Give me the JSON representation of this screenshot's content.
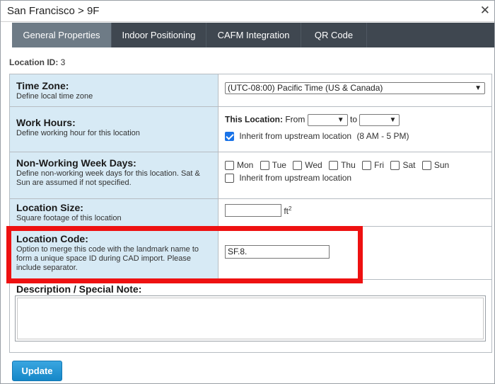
{
  "window": {
    "title": "San Francisco > 9F",
    "close_glyph": "✕"
  },
  "tabs": [
    {
      "label": "General Properties",
      "active": true
    },
    {
      "label": "Indoor Positioning",
      "active": false
    },
    {
      "label": "CAFM Integration",
      "active": false
    },
    {
      "label": "QR Code",
      "active": false
    }
  ],
  "location_id": {
    "label": "Location ID:",
    "value": "3"
  },
  "time_zone": {
    "title": "Time Zone:",
    "desc": "Define local time zone",
    "value": "(UTC-08:00) Pacific Time (US & Canada)"
  },
  "work_hours": {
    "title": "Work Hours:",
    "desc": "Define working hour for this location",
    "this_location_label": "This Location:",
    "from_label": "From",
    "to_label": "to",
    "from_value": "",
    "to_value": "",
    "inherit_label": "Inherit from upstream location",
    "inherit_checked": true,
    "inherit_hours": "(8 AM - 5 PM)"
  },
  "non_working": {
    "title": "Non-Working Week Days:",
    "desc": "Define non-working week days for this location. Sat & Sun are assumed if not specified.",
    "days": [
      "Mon",
      "Tue",
      "Wed",
      "Thu",
      "Fri",
      "Sat",
      "Sun"
    ],
    "inherit_label": "Inherit from upstream location"
  },
  "location_size": {
    "title": "Location Size:",
    "desc": "Square footage of this location",
    "value": "",
    "unit": "ft",
    "unit_sup": "2"
  },
  "location_code": {
    "title": "Location Code:",
    "desc": "Option to merge this code with the landmark name to form a unique space ID during CAD import. Please include separator.",
    "value": "SF.8."
  },
  "description": {
    "title": "Description / Special Note:",
    "value": ""
  },
  "actions": {
    "update_label": "Update"
  },
  "colors": {
    "tab_bar": "#3f4750",
    "tab_active": "#6e7b86",
    "label_cell": "#d7eaf5",
    "highlight": "#ee1111",
    "button": "#1587c8"
  }
}
